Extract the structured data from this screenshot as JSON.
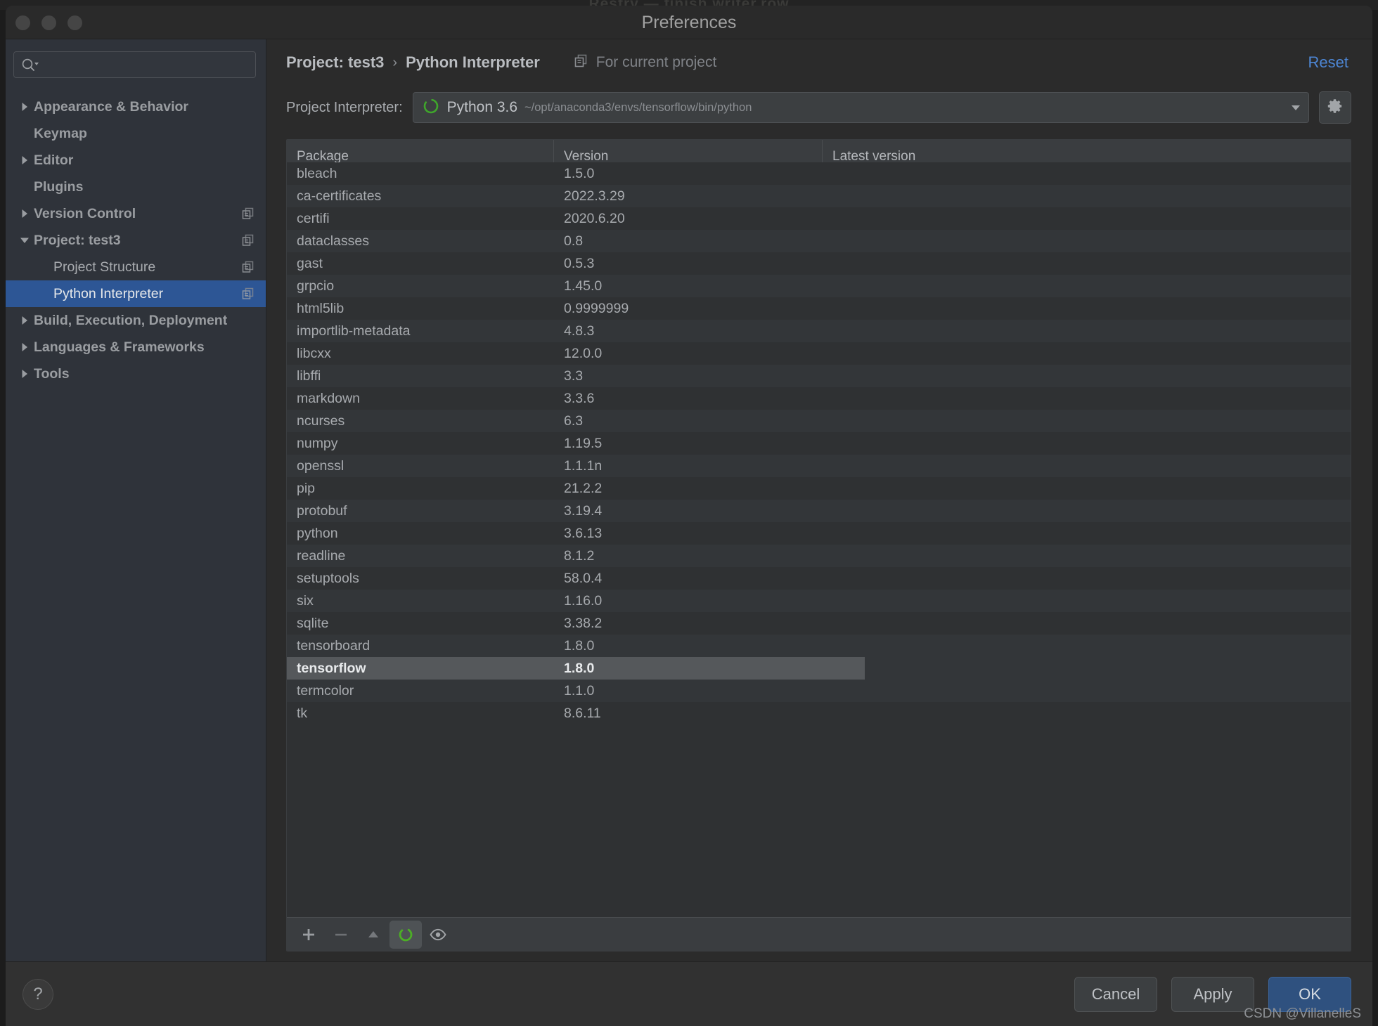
{
  "background_window": {
    "faint_text": "Restry — finish  writer.row"
  },
  "window": {
    "title": "Preferences",
    "traffic_lights": [
      "close",
      "minimize",
      "zoom"
    ]
  },
  "sidebar": {
    "search": {
      "value": "",
      "placeholder": ""
    },
    "items": [
      {
        "label": "Appearance & Behavior",
        "arrow": "collapsed",
        "child": false,
        "badge": false,
        "selected": false
      },
      {
        "label": "Keymap",
        "arrow": "none",
        "child": false,
        "badge": false,
        "selected": false
      },
      {
        "label": "Editor",
        "arrow": "collapsed",
        "child": false,
        "badge": false,
        "selected": false
      },
      {
        "label": "Plugins",
        "arrow": "none",
        "child": false,
        "badge": false,
        "selected": false
      },
      {
        "label": "Version Control",
        "arrow": "collapsed",
        "child": false,
        "badge": true,
        "selected": false
      },
      {
        "label": "Project: test3",
        "arrow": "expanded",
        "child": false,
        "badge": true,
        "selected": false
      },
      {
        "label": "Project Structure",
        "arrow": "none",
        "child": true,
        "badge": true,
        "selected": false
      },
      {
        "label": "Python Interpreter",
        "arrow": "none",
        "child": true,
        "badge": true,
        "selected": true
      },
      {
        "label": "Build, Execution, Deployment",
        "arrow": "collapsed",
        "child": false,
        "badge": false,
        "selected": false
      },
      {
        "label": "Languages & Frameworks",
        "arrow": "collapsed",
        "child": false,
        "badge": false,
        "selected": false
      },
      {
        "label": "Tools",
        "arrow": "collapsed",
        "child": false,
        "badge": false,
        "selected": false
      }
    ]
  },
  "main": {
    "breadcrumb": {
      "parent": "Project: test3",
      "separator": "›",
      "current": "Python Interpreter"
    },
    "scope_note": "For current project",
    "reset_label": "Reset",
    "interpreter": {
      "label": "Project Interpreter:",
      "name": "Python 3.6",
      "path": "~/opt/anaconda3/envs/tensorflow/bin/python"
    }
  },
  "table": {
    "columns": [
      "Package",
      "Version",
      "Latest version"
    ],
    "rows": [
      {
        "package": "bleach",
        "version": "1.5.0",
        "latest": "",
        "selected": false
      },
      {
        "package": "ca-certificates",
        "version": "2022.3.29",
        "latest": "",
        "selected": false
      },
      {
        "package": "certifi",
        "version": "2020.6.20",
        "latest": "",
        "selected": false
      },
      {
        "package": "dataclasses",
        "version": "0.8",
        "latest": "",
        "selected": false
      },
      {
        "package": "gast",
        "version": "0.5.3",
        "latest": "",
        "selected": false
      },
      {
        "package": "grpcio",
        "version": "1.45.0",
        "latest": "",
        "selected": false
      },
      {
        "package": "html5lib",
        "version": "0.9999999",
        "latest": "",
        "selected": false
      },
      {
        "package": "importlib-metadata",
        "version": "4.8.3",
        "latest": "",
        "selected": false
      },
      {
        "package": "libcxx",
        "version": "12.0.0",
        "latest": "",
        "selected": false
      },
      {
        "package": "libffi",
        "version": "3.3",
        "latest": "",
        "selected": false
      },
      {
        "package": "markdown",
        "version": "3.3.6",
        "latest": "",
        "selected": false
      },
      {
        "package": "ncurses",
        "version": "6.3",
        "latest": "",
        "selected": false
      },
      {
        "package": "numpy",
        "version": "1.19.5",
        "latest": "",
        "selected": false
      },
      {
        "package": "openssl",
        "version": "1.1.1n",
        "latest": "",
        "selected": false
      },
      {
        "package": "pip",
        "version": "21.2.2",
        "latest": "",
        "selected": false
      },
      {
        "package": "protobuf",
        "version": "3.19.4",
        "latest": "",
        "selected": false
      },
      {
        "package": "python",
        "version": "3.6.13",
        "latest": "",
        "selected": false
      },
      {
        "package": "readline",
        "version": "8.1.2",
        "latest": "",
        "selected": false
      },
      {
        "package": "setuptools",
        "version": "58.0.4",
        "latest": "",
        "selected": false
      },
      {
        "package": "six",
        "version": "1.16.0",
        "latest": "",
        "selected": false
      },
      {
        "package": "sqlite",
        "version": "3.38.2",
        "latest": "",
        "selected": false
      },
      {
        "package": "tensorboard",
        "version": "1.8.0",
        "latest": "",
        "selected": false
      },
      {
        "package": "tensorflow",
        "version": "1.8.0",
        "latest": "",
        "selected": true
      },
      {
        "package": "termcolor",
        "version": "1.1.0",
        "latest": "",
        "selected": false
      },
      {
        "package": "tk",
        "version": "8.6.11",
        "latest": "",
        "selected": false
      }
    ],
    "toolbar": [
      {
        "icon": "plus-icon",
        "pressed": false
      },
      {
        "icon": "minus-icon",
        "pressed": false
      },
      {
        "icon": "upgrade-arrow-icon",
        "pressed": false
      },
      {
        "icon": "refresh-spinner-icon",
        "pressed": true
      },
      {
        "icon": "eye-icon",
        "pressed": false
      }
    ]
  },
  "footer": {
    "help_label": "?",
    "buttons": [
      {
        "label": "Cancel",
        "primary": false
      },
      {
        "label": "Apply",
        "primary": false
      },
      {
        "label": "OK",
        "primary": true
      }
    ],
    "watermark": "CSDN @VillanelleS"
  },
  "colors": {
    "selection_blue": "#2d5695",
    "accent_link": "#4d86d4",
    "primary_button": "#2f517f",
    "spinner_green": "#4caf25"
  }
}
